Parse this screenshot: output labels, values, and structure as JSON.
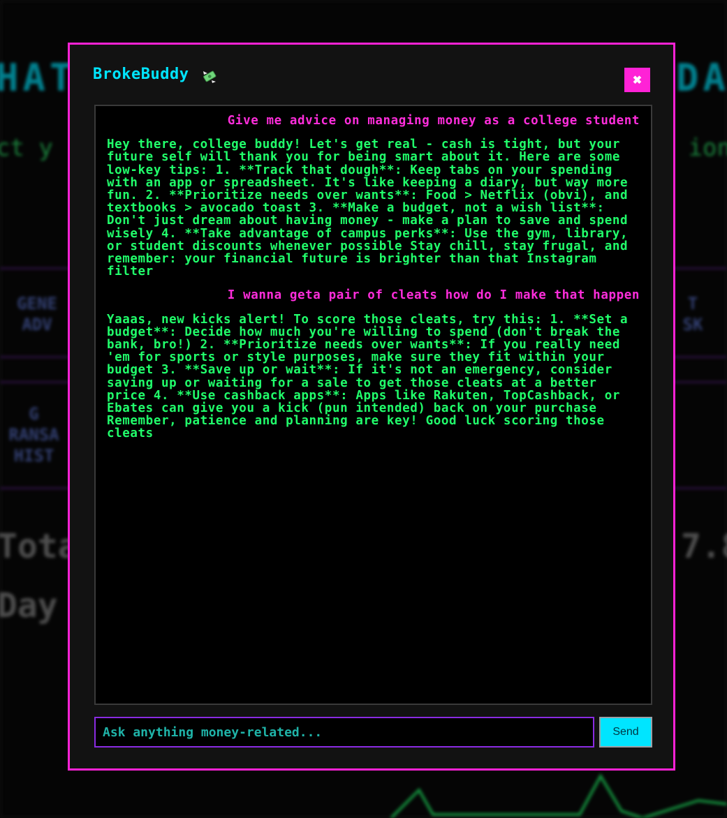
{
  "background": {
    "title_left": "HAT",
    "title_right": "DA",
    "subtitle_left": "ct y",
    "subtitle_right": "ion",
    "button_1_left": "GENE\nADV",
    "button_1_right": "T\nSK",
    "button_2_left": "G\nRANSA\nHIST",
    "total_left": "Tota",
    "total_right": "7.8",
    "day_left": "Day"
  },
  "chat": {
    "title": "BrokeBuddy",
    "title_icon": "money-with-wings-icon",
    "close_label": "✖",
    "messages": [
      {
        "role": "user",
        "text": "Give me advice on managing money as a college student"
      },
      {
        "role": "bot",
        "text": "Hey there, college buddy! Let's get real - cash is tight, but your future self will thank you for being smart about it. Here are some low-key tips: 1. **Track that dough**: Keep tabs on your spending with an app or spreadsheet. It's like keeping a diary, but way more fun. 2. **Prioritize needs over wants**: Food > Netflix (obvi), and textbooks > avocado toast 3. **Make a budget, not a wish list**: Don't just dream about having money - make a plan to save and spend wisely 4. **Take advantage of campus perks**: Use the gym, library, or student discounts whenever possible Stay chill, stay frugal, and remember: your financial future is brighter than that Instagram filter"
      },
      {
        "role": "user",
        "text": "I wanna geta pair of cleats how do I make that happen"
      },
      {
        "role": "bot",
        "text": "Yaaas, new kicks alert! To score those cleats, try this: 1. **Set a budget**: Decide how much you're willing to spend (don't break the bank, bro!) 2. **Prioritize needs over wants**: If you really need 'em for sports or style purposes, make sure they fit within your budget 3. **Save up or wait**: If it's not an emergency, consider saving up or waiting for a sale to get those cleats at a better price 4. **Use cashback apps**: Apps like Rakuten, TopCashback, or Ebates can give you a kick (pun intended) back on your purchase Remember, patience and planning are key! Good luck scoring those cleats"
      }
    ],
    "input_placeholder": "Ask anything money-related...",
    "input_value": "",
    "send_label": "Send"
  },
  "colors": {
    "accent_pink": "#ff22d6",
    "accent_cyan": "#00e5ff",
    "bot_text": "#21ff6b",
    "user_text": "#ff2ddb",
    "input_border": "#8a2be2"
  }
}
